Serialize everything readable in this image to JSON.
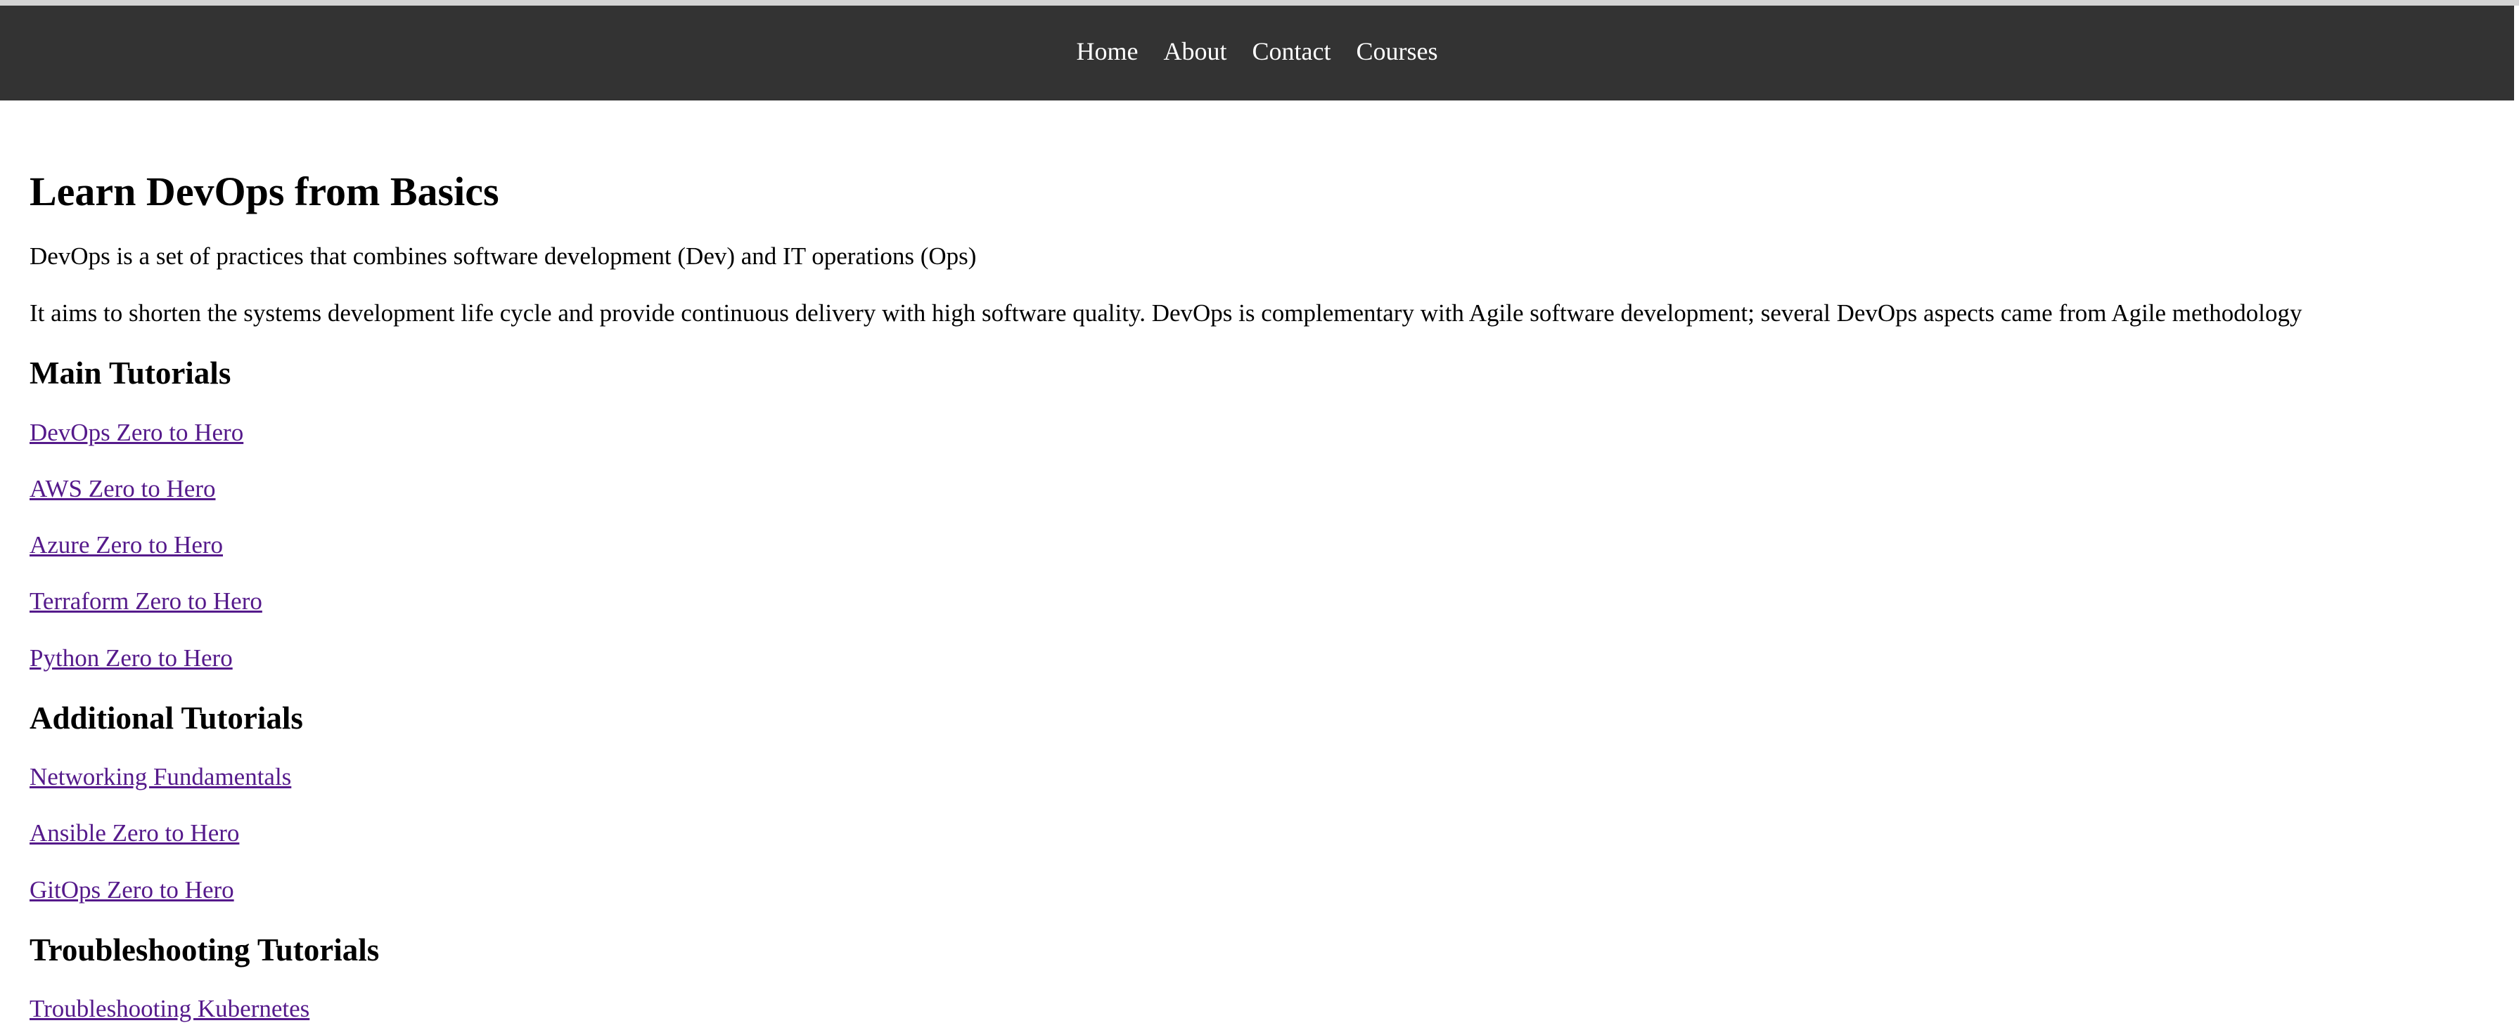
{
  "page": {
    "title": "Learn DevOps from Basics",
    "background_color": "#ffffff",
    "text_color": "#000000"
  },
  "header": {
    "background_color": "#333333",
    "link_color": "#ffffff",
    "nav": [
      {
        "label": "Home"
      },
      {
        "label": "About"
      },
      {
        "label": "Contact"
      },
      {
        "label": "Courses"
      }
    ]
  },
  "main": {
    "heading": "Learn DevOps from Basics",
    "paragraphs": [
      "DevOps is a set of practices that combines software development (Dev) and IT operations (Ops)",
      "It aims to shorten the systems development life cycle and provide continuous delivery with high software quality. DevOps is complementary with Agile software development; several DevOps aspects came from Agile methodology"
    ],
    "link_color": "#551a8b",
    "sections": [
      {
        "heading": "Main Tutorials",
        "links": [
          {
            "label": "DevOps Zero to Hero"
          },
          {
            "label": "AWS Zero to Hero"
          },
          {
            "label": "Azure Zero to Hero"
          },
          {
            "label": "Terraform Zero to Hero"
          },
          {
            "label": "Python Zero to Hero"
          }
        ]
      },
      {
        "heading": "Additional Tutorials",
        "links": [
          {
            "label": "Networking Fundamentals"
          },
          {
            "label": "Ansible Zero to Hero"
          },
          {
            "label": "GitOps Zero to Hero"
          }
        ]
      },
      {
        "heading": "Troubleshooting Tutorials",
        "links": [
          {
            "label": "Troubleshooting Kubernetes"
          }
        ]
      }
    ]
  }
}
